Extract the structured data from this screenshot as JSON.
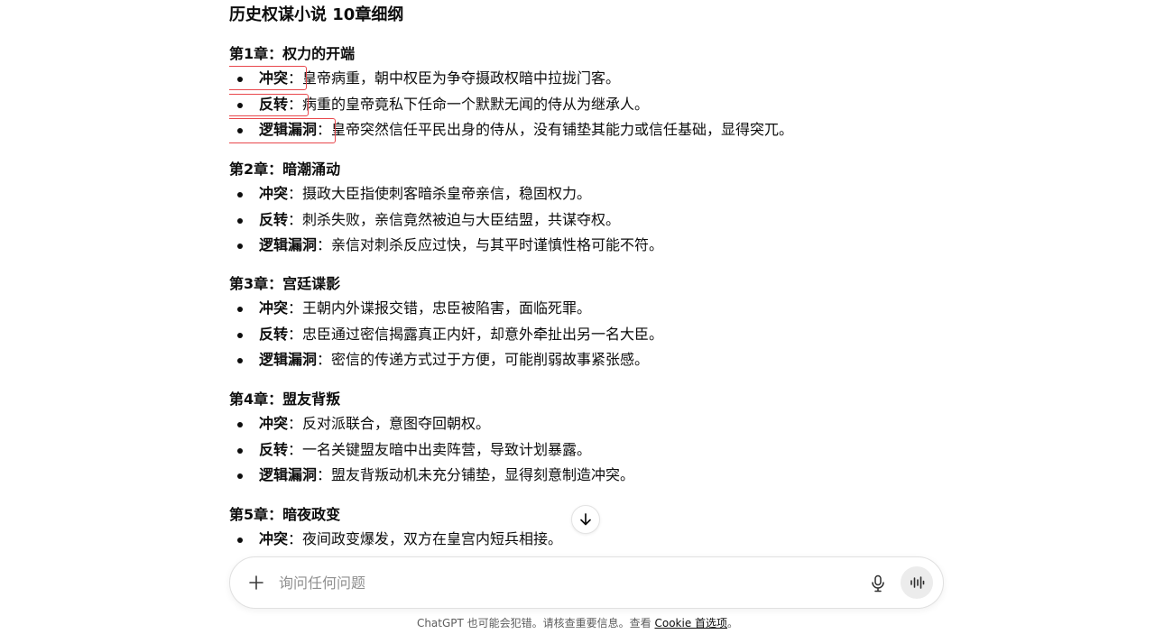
{
  "document": {
    "title": "历史权谋小说 10章细纲",
    "chapters": [
      {
        "title": "第1章：权力的开端",
        "items": [
          {
            "key": "冲突",
            "sep": "：",
            "text": "皇帝病重，朝中权臣为争夺摄政权暗中拉拢门客。"
          },
          {
            "key": "反转",
            "sep": "：",
            "text": "病重的皇帝竟私下任命一个默默无闻的侍从为继承人。"
          },
          {
            "key": "逻辑漏洞",
            "sep": "：",
            "text": "皇帝突然信任平民出身的侍从，没有铺垫其能力或信任基础，显得突兀。"
          }
        ]
      },
      {
        "title": "第2章：暗潮涌动",
        "items": [
          {
            "key": "冲突",
            "sep": "：",
            "text": "摄政大臣指使刺客暗杀皇帝亲信，稳固权力。"
          },
          {
            "key": "反转",
            "sep": "：",
            "text": "刺杀失败，亲信竟然被迫与大臣结盟，共谋夺权。"
          },
          {
            "key": "逻辑漏洞",
            "sep": "：",
            "text": "亲信对刺杀反应过快，与其平时谨慎性格可能不符。"
          }
        ]
      },
      {
        "title": "第3章：宫廷谍影",
        "items": [
          {
            "key": "冲突",
            "sep": "：",
            "text": "王朝内外谍报交错，忠臣被陷害，面临死罪。"
          },
          {
            "key": "反转",
            "sep": "：",
            "text": "忠臣通过密信揭露真正内奸，却意外牵扯出另一名大臣。"
          },
          {
            "key": "逻辑漏洞",
            "sep": "：",
            "text": "密信的传递方式过于方便，可能削弱故事紧张感。"
          }
        ]
      },
      {
        "title": "第4章：盟友背叛",
        "items": [
          {
            "key": "冲突",
            "sep": "：",
            "text": "反对派联合，意图夺回朝权。"
          },
          {
            "key": "反转",
            "sep": "：",
            "text": "一名关键盟友暗中出卖阵营，导致计划暴露。"
          },
          {
            "key": "逻辑漏洞",
            "sep": "：",
            "text": "盟友背叛动机未充分铺垫，显得刻意制造冲突。"
          }
        ]
      },
      {
        "title": "第5章：暗夜政变",
        "items": [
          {
            "key": "冲突",
            "sep": "：",
            "text": "夜间政变爆发，双方在皇宫内短兵相接。"
          }
        ]
      }
    ]
  },
  "composer": {
    "placeholder": "询问任何问题",
    "plus_icon": "plus-icon",
    "mic_icon": "microphone-icon",
    "voice_icon": "voice-waveform-icon"
  },
  "scroll_icon": "arrow-down-icon",
  "footer": {
    "text": "ChatGPT 也可能会犯错。请核查重要信息。查看 ",
    "link": "Cookie 首选项",
    "suffix": "。"
  },
  "colors": {
    "highlight_border": "#e8474c",
    "text": "#0d0d0d",
    "muted": "#5d5d5d"
  }
}
